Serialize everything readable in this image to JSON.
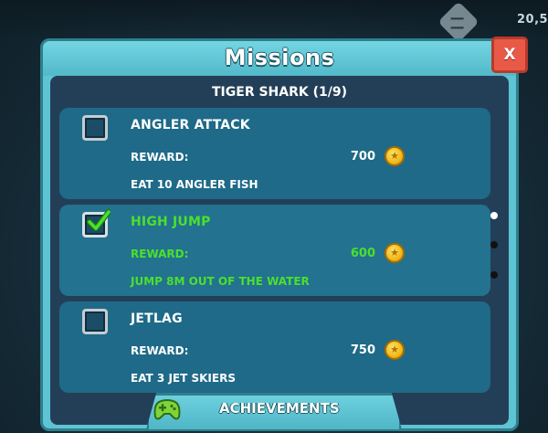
{
  "hud": {
    "score": "20,5",
    "menu_icon": "list-icon"
  },
  "panel": {
    "title": "Missions",
    "close_label": "X",
    "subtitle": "TIGER SHARK (1/9)"
  },
  "missions": [
    {
      "title": "ANGLER ATTACK",
      "reward_label": "REWARD:",
      "reward": "700",
      "description": "EAT 10 ANGLER FISH",
      "completed": false
    },
    {
      "title": "HIGH JUMP",
      "reward_label": "REWARD:",
      "reward": "600",
      "description": "JUMP 8M OUT OF THE WATER",
      "completed": true
    },
    {
      "title": "JETLAG",
      "reward_label": "REWARD:",
      "reward": "750",
      "description": "EAT 3 JET SKIERS",
      "completed": false
    }
  ],
  "pagination": {
    "pages": 3,
    "active": 1
  },
  "footer": {
    "achievements_label": "ACHIEVEMENTS",
    "icon": "gamepad-icon"
  },
  "colors": {
    "panel": "#5ec4d4",
    "inner": "#233f57",
    "card": "#1e6a88",
    "complete_green": "#4be02c",
    "close_red": "#e85a47"
  }
}
